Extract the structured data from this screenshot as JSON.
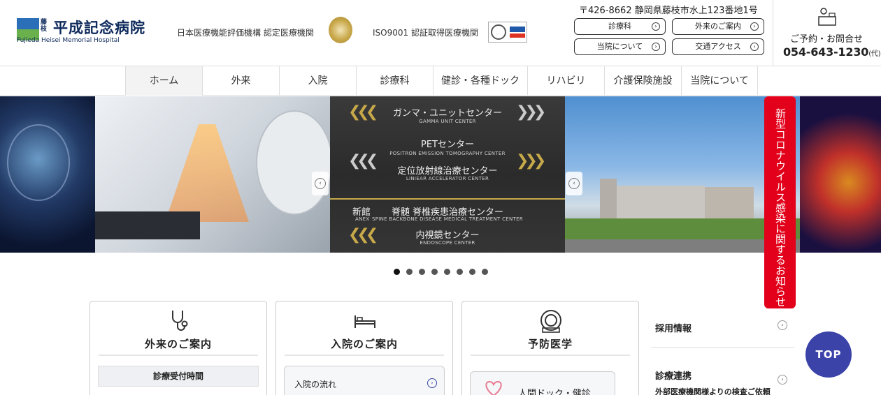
{
  "header": {
    "logo": {
      "small_kanji": "藤枝",
      "name": "平成記念病院",
      "name_en": "Fujieda Heisei Memorial Hospital",
      "mark_colors": [
        "#2a6fb8",
        "#6ab04c"
      ]
    },
    "certifications": [
      {
        "label": "日本医療機能評価機構 認定医療機関",
        "badge_icon": "jq-hospital-seal-icon"
      },
      {
        "label": "ISO9001 認証取得医療機関",
        "badge_icon": "iso-cert-mark-icon"
      }
    ],
    "address": "〒426-8662 静岡県藤枝市水上123番地1号",
    "buttons": [
      {
        "label": "診療科"
      },
      {
        "label": "外来のご案内"
      },
      {
        "label": "当院について"
      },
      {
        "label": "交通アクセス"
      }
    ],
    "contact": {
      "label": "ご予約・お問合せ",
      "phone": "054-643-1230",
      "phone_suffix": "(代)",
      "icon": "reception-desk-icon"
    }
  },
  "nav": {
    "items": [
      {
        "label": "ホーム",
        "active": true
      },
      {
        "label": "外来"
      },
      {
        "label": "入院"
      },
      {
        "label": "診療科"
      },
      {
        "label": "健診・各種ドック"
      },
      {
        "label": "リハビリ"
      },
      {
        "label": "介護保険施設"
      },
      {
        "label": "当院について"
      }
    ]
  },
  "slider": {
    "sign": [
      {
        "jp": "ガンマ・ユニットセンター",
        "en": "GAMMA UNIT CENTER"
      },
      {
        "jp": "PETセンター",
        "en": "POSITRON EMISSION TOMOGRAPHY CENTER"
      },
      {
        "jp": "定位放射線治療センター",
        "en": "LINIEAR ACCELERATOR CENTER"
      },
      {
        "prefix_jp": "新館",
        "prefix_en": "ANEX",
        "jp": "脊髄 脊椎疾患治療センター",
        "en": "SPINE BACKBONE DISEASE MEDICAL TREATMENT CENTER"
      },
      {
        "jp": "内視鏡センター",
        "en": "ENDOSCOPE CENTER"
      }
    ],
    "prev_icon": "chevron-left-icon",
    "next_icon": "chevron-left-icon",
    "dot_count": 8,
    "active_dot": 0
  },
  "covid_banner": "新型コロナウイルス感染に関するお知らせ",
  "cards": [
    {
      "title": "外来のご案内",
      "icon": "stethoscope-icon",
      "sub": "診療受付時間"
    },
    {
      "title": "入院のご案内",
      "icon": "bed-icon",
      "link": "入院の流れ"
    },
    {
      "title": "予防医学",
      "icon": "mri-scanner-icon",
      "link": "人間ドック・健診"
    }
  ],
  "side_links": [
    {
      "label": "採用情報"
    },
    {
      "label": "診療連携",
      "sub": "外部医療機関様よりの検査ご依頼"
    }
  ],
  "top_button": "TOP"
}
